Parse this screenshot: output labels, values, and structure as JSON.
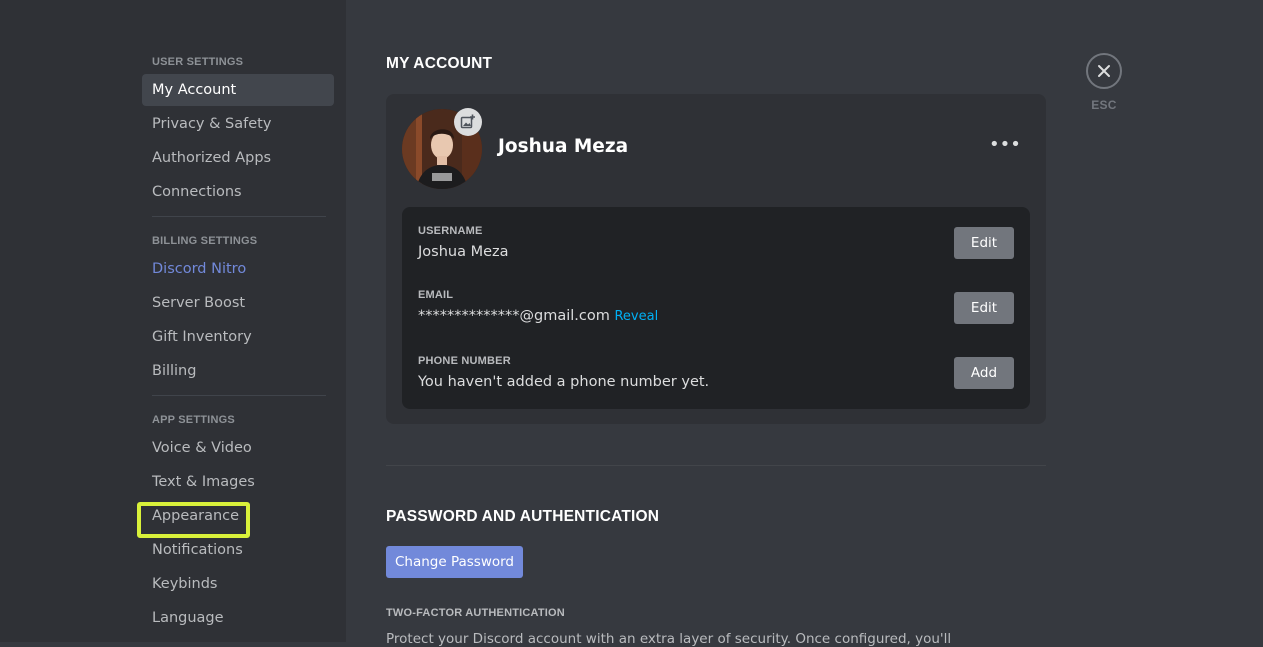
{
  "sidebar": {
    "user_settings": {
      "header": "USER SETTINGS",
      "items": [
        "My Account",
        "Privacy & Safety",
        "Authorized Apps",
        "Connections"
      ]
    },
    "billing_settings": {
      "header": "BILLING SETTINGS",
      "items": [
        "Discord Nitro",
        "Server Boost",
        "Gift Inventory",
        "Billing"
      ]
    },
    "app_settings": {
      "header": "APP SETTINGS",
      "items": [
        "Voice & Video",
        "Text & Images",
        "Appearance",
        "Notifications",
        "Keybinds",
        "Language"
      ]
    }
  },
  "main": {
    "title": "MY ACCOUNT",
    "profile": {
      "display_name": "Joshua Meza",
      "more_label": "•••"
    },
    "fields": {
      "username": {
        "label": "USERNAME",
        "value": "Joshua Meza",
        "button": "Edit"
      },
      "email": {
        "label": "EMAIL",
        "value": "**************@gmail.com",
        "reveal": "Reveal",
        "button": "Edit"
      },
      "phone": {
        "label": "PHONE NUMBER",
        "value": "You haven't added a phone number yet.",
        "button": "Add"
      }
    },
    "password_section": {
      "title": "PASSWORD AND AUTHENTICATION",
      "change_password_button": "Change Password",
      "two_factor_label": "TWO-FACTOR AUTHENTICATION",
      "two_factor_desc": "Protect your Discord account with an extra layer of security. Once configured, you'll"
    }
  },
  "close": {
    "label": "ESC",
    "icon": "close-icon"
  },
  "colors": {
    "accent": "#7289da",
    "link": "#00b0f4",
    "highlight": "#d9f13a"
  }
}
